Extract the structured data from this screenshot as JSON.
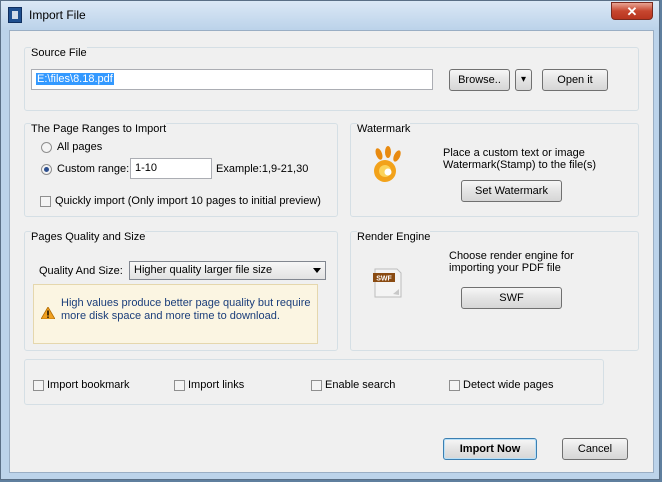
{
  "window": {
    "title": "Import File",
    "close_glyph": "✕"
  },
  "source": {
    "group_title": "Source File",
    "path_value": "E:\\files\\8.18.pdf",
    "browse_label": "Browse..",
    "dropdown_glyph": "▾",
    "open_label": "Open it"
  },
  "ranges": {
    "group_title": "The Page Ranges to Import",
    "all_pages_label": "All pages",
    "custom_range_label": "Custom range:",
    "custom_range_value": "1-10",
    "example_label": "Example:1,9-21,30",
    "quick_import_label": "Quickly import (Only import 10 pages to  initial  preview)",
    "selected": "custom"
  },
  "watermark": {
    "group_title": "Watermark",
    "description": "Place a custom text or image\nWatermark(Stamp) to the file(s)",
    "button_label": "Set Watermark"
  },
  "quality": {
    "group_title": "Pages Quality and Size",
    "select_label": "Quality And Size:",
    "select_value": "Higher quality larger file size",
    "info_text": "High values produce better page quality but require\nmore disk space and more time to download."
  },
  "render": {
    "group_title": "Render Engine",
    "description": "Choose render engine for\nimporting your PDF file",
    "button_label": "SWF",
    "icon_label": "SWF"
  },
  "options": {
    "bookmark_label": "Import bookmark",
    "links_label": "Import links",
    "search_label": "Enable search",
    "wide_label": "Detect wide pages"
  },
  "footer": {
    "import_label": "Import Now",
    "cancel_label": "Cancel"
  },
  "colors": {
    "accent": "#3399ff",
    "info_text": "#1a3d7a",
    "info_bg": "#fbf5e2"
  }
}
